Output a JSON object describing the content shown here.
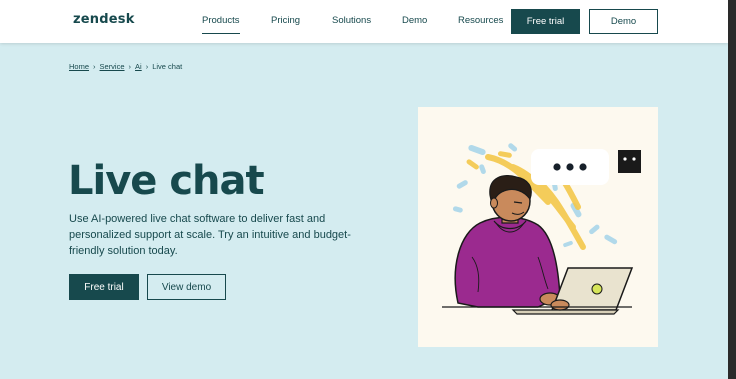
{
  "brand": {
    "logo_text": "zendesk"
  },
  "nav": {
    "items": [
      {
        "label": "Products",
        "active": true
      },
      {
        "label": "Pricing",
        "active": false
      },
      {
        "label": "Solutions",
        "active": false
      },
      {
        "label": "Demo",
        "active": false
      },
      {
        "label": "Resources",
        "active": false
      }
    ],
    "free_trial_label": "Free trial",
    "demo_label": "Demo"
  },
  "breadcrumb": {
    "items": [
      "Home",
      "Service",
      "Ai"
    ],
    "current": "Live chat"
  },
  "hero": {
    "title": "Live chat",
    "description": "Use AI-powered live chat software to deliver fast and personalized support at scale. Try an intuitive and budget-friendly solution today.",
    "free_trial_label": "Free trial",
    "view_demo_label": "View demo"
  },
  "colors": {
    "brand_dark": "#17494d",
    "page_bg": "#d4ecf0",
    "illustration_bg": "#fdf9ef",
    "shirt_purple": "#9b2a8f"
  },
  "icons": {
    "typing_bubble": "chat-typing-icon",
    "chat_square": "chat-dots-icon"
  }
}
